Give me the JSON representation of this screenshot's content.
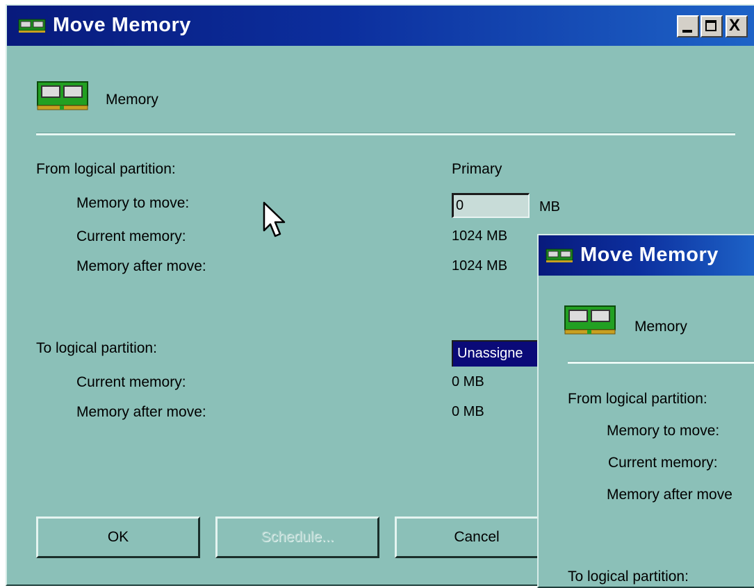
{
  "window": {
    "title": "Move Memory",
    "controls": {
      "minimize": "_",
      "maximize": "□",
      "close": "X"
    }
  },
  "header": {
    "section_label": "Memory"
  },
  "from": {
    "heading": "From logical partition:",
    "partition": "Primary",
    "memory_to_move_label": "Memory to move:",
    "memory_to_move_value": "0",
    "memory_unit": "MB",
    "current_memory_label": "Current memory:",
    "current_memory_value": "1024 MB",
    "after_move_label": "Memory after move:",
    "after_move_value": "1024 MB"
  },
  "to": {
    "heading": "To logical partition:",
    "partition": "Unassigne",
    "current_memory_label": "Current memory:",
    "current_memory_value": "0 MB",
    "after_move_label": "Memory after move:",
    "after_move_value": "0 MB"
  },
  "buttons": {
    "ok": "OK",
    "schedule": "Schedule...",
    "cancel": "Cancel"
  },
  "second_window": {
    "title": "Move Memory",
    "section_label": "Memory",
    "from_heading": "From logical partition:",
    "memory_to_move_label": "Memory to move:",
    "current_memory_label": "Current memory:",
    "after_move_label": "Memory after move",
    "to_heading": "To logical partition:"
  },
  "colors": {
    "window_bg": "#8bc0b8",
    "titlebar": "#0c2f9e",
    "selection": "#0a0a78"
  }
}
